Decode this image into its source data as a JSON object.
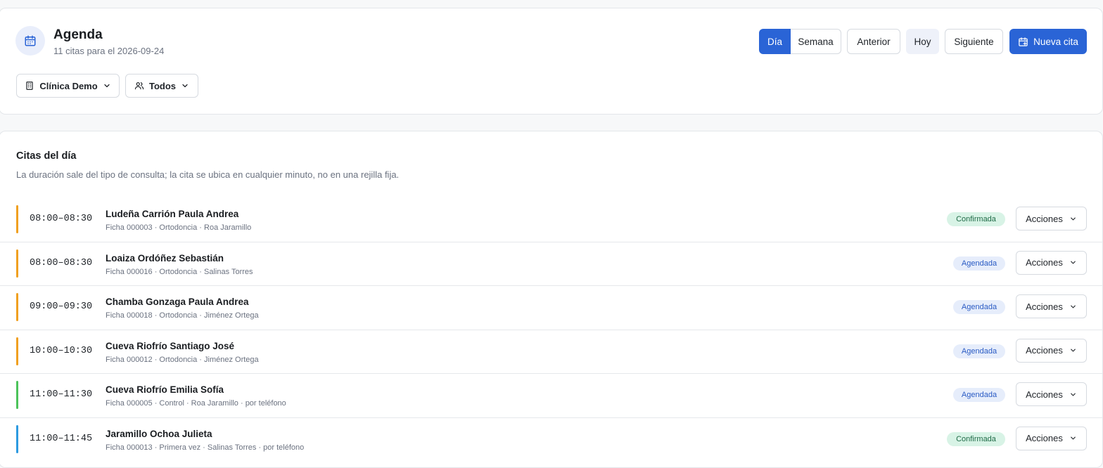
{
  "header": {
    "title": "Agenda",
    "subtitle": "11 citas para el 2026-09-24",
    "icon": "calendar-icon",
    "view_toggle": {
      "day_label": "Día",
      "week_label": "Semana",
      "selected": "Día"
    },
    "prev_label": "Anterior",
    "today_label": "Hoy",
    "next_label": "Siguiente",
    "new_label": "Nueva cita",
    "filters": {
      "clinic_label": "Clínica Demo",
      "staff_label": "Todos"
    }
  },
  "list": {
    "title": "Citas del día",
    "description": "La duración sale del tipo de consulta; la cita se ubica en cualquier minuto, no en una rejilla fija.",
    "actions_label": "Acciones",
    "rows": [
      {
        "time": "08:00–08:30",
        "name": "Ludeña Carrión Paula Andrea",
        "meta": "Ficha 000003 · Ortodoncia · Roa Jaramillo",
        "status": "Confirmada",
        "status_kind": "confirmed",
        "color": "#f0a020"
      },
      {
        "time": "08:00–08:30",
        "name": "Loaiza Ordóñez Sebastián",
        "meta": "Ficha 000016 · Ortodoncia · Salinas Torres",
        "status": "Agendada",
        "status_kind": "scheduled",
        "color": "#f0a020"
      },
      {
        "time": "09:00–09:30",
        "name": "Chamba Gonzaga Paula Andrea",
        "meta": "Ficha 000018 · Ortodoncia · Jiménez Ortega",
        "status": "Agendada",
        "status_kind": "scheduled",
        "color": "#f0a020"
      },
      {
        "time": "10:00–10:30",
        "name": "Cueva Riofrío Santiago José",
        "meta": "Ficha 000012 · Ortodoncia · Jiménez Ortega",
        "status": "Agendada",
        "status_kind": "scheduled",
        "color": "#f0a020"
      },
      {
        "time": "11:00–11:30",
        "name": "Cueva Riofrío Emilia Sofía",
        "meta": "Ficha 000005 · Control · Roa Jaramillo · por teléfono",
        "status": "Agendada",
        "status_kind": "scheduled",
        "color": "#4cc35a"
      },
      {
        "time": "11:00–11:45",
        "name": "Jaramillo Ochoa Julieta",
        "meta": "Ficha 000013 · Primera vez · Salinas Torres · por teléfono",
        "status": "Confirmada",
        "status_kind": "confirmed",
        "color": "#2d9ae0"
      }
    ]
  },
  "colors": {
    "accent": "#2a64d6",
    "confirmed_bg": "#d8f3e6",
    "scheduled_bg": "#e6edfb"
  }
}
